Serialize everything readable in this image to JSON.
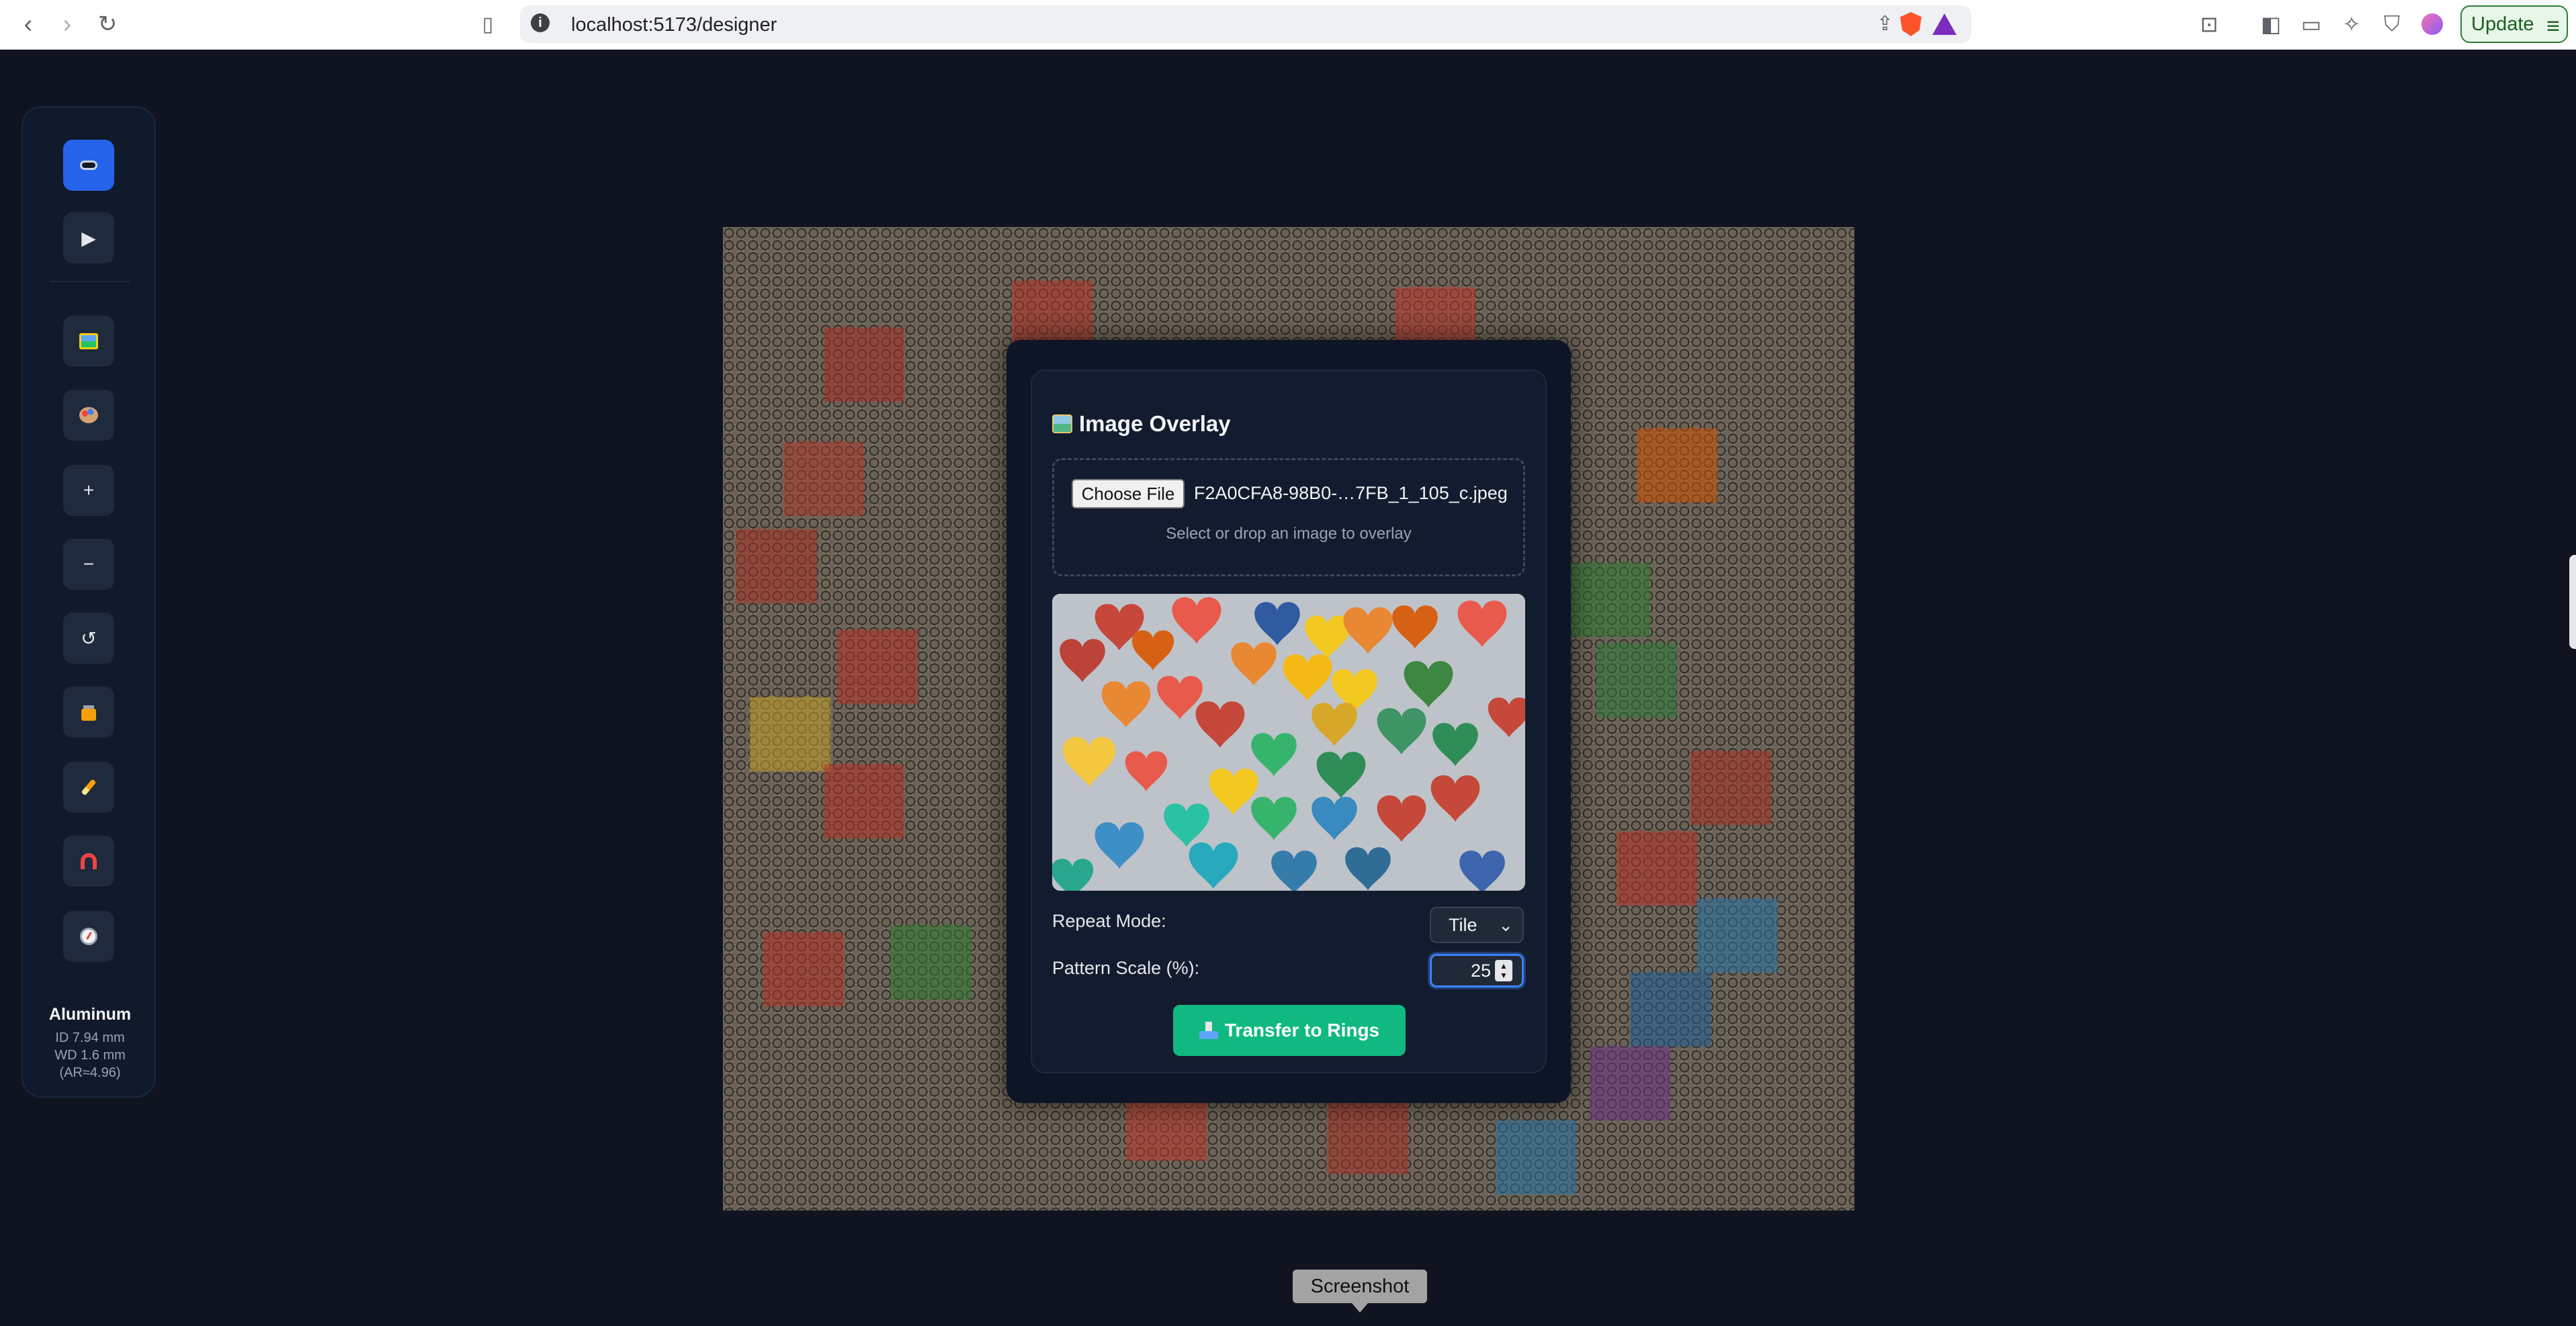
{
  "browser": {
    "back_icon": "arrow-left-icon",
    "forward_icon": "arrow-right-icon",
    "reload_icon": "reload-icon",
    "bookmark_icon": "bookmark-icon",
    "url": "localhost:5173/designer",
    "update_label": "Update"
  },
  "sidebar": {
    "tools": [
      {
        "name": "chainmail-mode",
        "glyph": "▬",
        "active": true
      },
      {
        "name": "play",
        "glyph": "▶"
      },
      {
        "name": "image-overlay",
        "glyph": "▣"
      },
      {
        "name": "palette",
        "glyph": "◕"
      },
      {
        "name": "zoom-in",
        "glyph": "+"
      },
      {
        "name": "zoom-out",
        "glyph": "−"
      },
      {
        "name": "reset",
        "glyph": "↺"
      },
      {
        "name": "lock",
        "glyph": "🔒"
      },
      {
        "name": "brush",
        "glyph": "✎"
      },
      {
        "name": "magnet",
        "glyph": "∩"
      },
      {
        "name": "compass",
        "glyph": "◎"
      }
    ],
    "material": {
      "name": "Aluminum",
      "id": "ID 7.94 mm",
      "wd": "WD 1.6 mm",
      "ar": "(AR≈4.96)"
    }
  },
  "overlay_panel": {
    "title": "Image Overlay",
    "choose_file_label": "Choose File",
    "file_name": "F2A0CFA8-98B0-…7FB_1_105_c.jpeg",
    "drop_hint": "Select or drop an image to overlay",
    "repeat_mode_label": "Repeat Mode:",
    "repeat_mode_value": "Tile",
    "pattern_scale_label": "Pattern Scale (%):",
    "pattern_scale_value": "25",
    "transfer_label": "Transfer to Rings"
  },
  "tooltip": {
    "text": "Screenshot"
  },
  "colors": {
    "accent_blue": "#2563eb",
    "transfer_green": "#10b981",
    "panel_bg": "#131c2e",
    "page_bg": "#0f1420"
  }
}
